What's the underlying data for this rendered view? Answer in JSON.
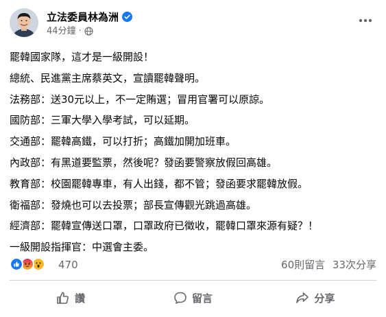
{
  "post": {
    "author": "立法委員林為洲",
    "time": "44分鐘",
    "separator": "·",
    "icons": {
      "verified": "verified-badge-icon",
      "audience": "globe-icon",
      "menu": "more-options-icon"
    },
    "lines": [
      "罷韓國家隊，這才是一級開設！",
      "總統、民進黨主席蔡英文，宣讀罷韓聲明。",
      "法務部：送30元以上，不一定賄選；冒用官署可以原諒。",
      "國防部：三軍大學入學考試，可以延期。",
      "交通部：罷韓高鐵，可以打折；高鐵加開加班車。",
      "內政部：有黑道要監票，然後呢？發函要警察放假回高雄。",
      "教育部：校園罷韓專車，有人出錢，都不管；發函要求罷韓放假。",
      "衛福部：發燒也可以去投票；部長宣傳觀光跳過高雄。",
      "經濟部：罷韓宣傳送口罩，口罩政府已徵收，罷韓口罩來源有疑？！",
      "一級開設指揮官：中選會主委。"
    ]
  },
  "stats": {
    "reaction_icons": [
      "like-reaction-icon",
      "angry-reaction-icon",
      "wow-reaction-icon"
    ],
    "reaction_count": "470",
    "comments": "60則留言",
    "shares": "33次分享"
  },
  "actions": {
    "like": "讚",
    "comment": "留言",
    "share": "分享"
  },
  "colors": {
    "verified": "#1877f2",
    "like": "#1877f2",
    "angry": "#e9710f",
    "wow": "#f7b928",
    "muted": "#65676b"
  }
}
